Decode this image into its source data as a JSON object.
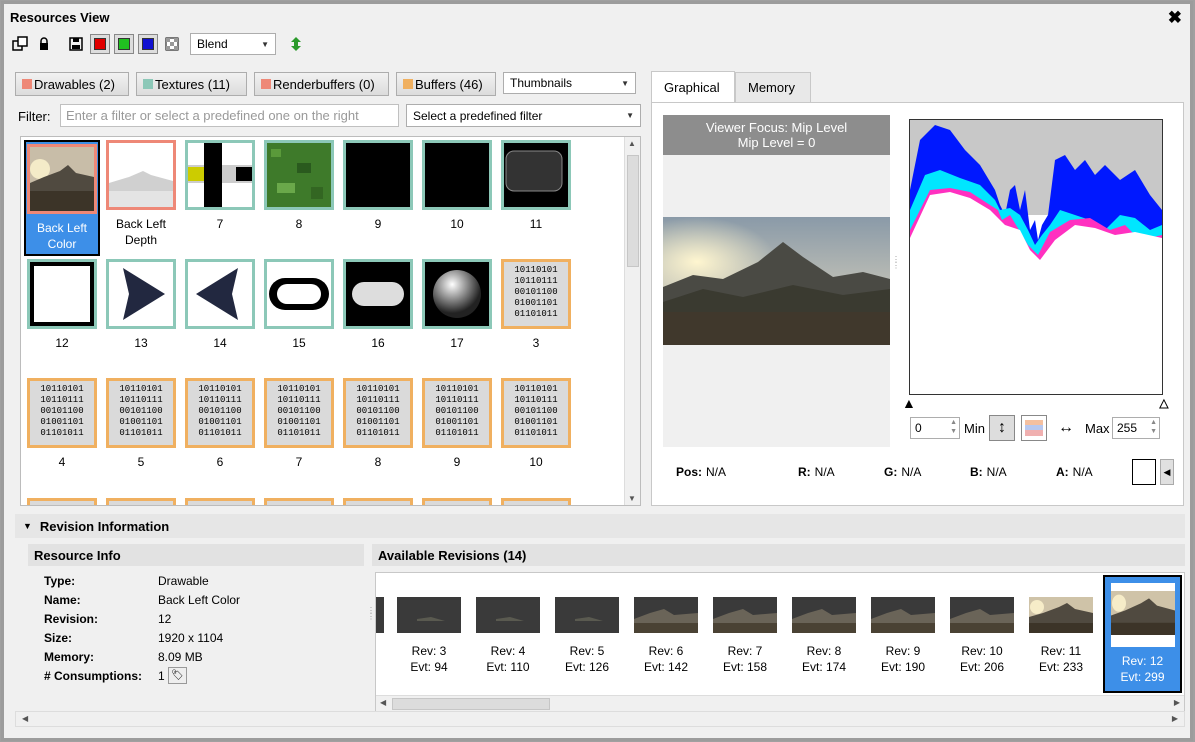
{
  "window": {
    "title": "Resources View",
    "close": "✖"
  },
  "toolbar": {
    "blend": "Blend",
    "colors": {
      "red": "#e00000",
      "green": "#20c020",
      "blue": "#1010d0"
    }
  },
  "types": [
    {
      "label": "Drawables (2)",
      "color": "#ee8877"
    },
    {
      "label": "Textures (11)",
      "color": "#8cc8b8"
    },
    {
      "label": "Renderbuffers (0)",
      "color": "#ee8877"
    },
    {
      "label": "Buffers (46)",
      "color": "#f0b060"
    }
  ],
  "view_mode": "Thumbnails",
  "filter": {
    "label": "Filter:",
    "placeholder": "Enter a filter or select a predefined one on the right",
    "predefined": "Select a predefined filter"
  },
  "resources": [
    {
      "label": "Back Left Color",
      "kind": "drawable",
      "img": "landscape",
      "selected": true
    },
    {
      "label": "Back Left Depth",
      "kind": "drawable",
      "img": "depth"
    },
    {
      "label": "7",
      "kind": "texture",
      "img": "blocks"
    },
    {
      "label": "8",
      "kind": "texture",
      "img": "grass"
    },
    {
      "label": "9",
      "kind": "texture",
      "img": "black"
    },
    {
      "label": "10",
      "kind": "texture",
      "img": "black"
    },
    {
      "label": "11",
      "kind": "texture",
      "img": "roundrect"
    },
    {
      "label": "12",
      "kind": "texture",
      "img": "whitebox"
    },
    {
      "label": "13",
      "kind": "texture",
      "img": "arrowright"
    },
    {
      "label": "14",
      "kind": "texture",
      "img": "arrowleft"
    },
    {
      "label": "15",
      "kind": "texture",
      "img": "pill"
    },
    {
      "label": "16",
      "kind": "texture",
      "img": "pillsolid"
    },
    {
      "label": "17",
      "kind": "texture",
      "img": "sphere"
    },
    {
      "label": "3",
      "kind": "buffer",
      "img": "binary"
    },
    {
      "label": "4",
      "kind": "buffer",
      "img": "binary"
    },
    {
      "label": "5",
      "kind": "buffer",
      "img": "binary"
    },
    {
      "label": "6",
      "kind": "buffer",
      "img": "binary"
    },
    {
      "label": "7",
      "kind": "buffer",
      "img": "binary"
    },
    {
      "label": "8",
      "kind": "buffer",
      "img": "binary"
    },
    {
      "label": "9",
      "kind": "buffer",
      "img": "binary"
    },
    {
      "label": "10",
      "kind": "buffer",
      "img": "binary"
    }
  ],
  "binary_text": [
    "10110101",
    "10110111",
    "00101100",
    "01001101",
    "01101011"
  ],
  "tabs": {
    "graphical": "Graphical",
    "memory": "Memory"
  },
  "viewer": {
    "focus_line1": "Viewer Focus: Mip Level",
    "focus_line2": "Mip Level = 0"
  },
  "histogram": {
    "min_value": "0",
    "min_label": "Min",
    "max_label": "Max",
    "max_value": "255"
  },
  "pixel": {
    "pos_label": "Pos:",
    "pos": "N/A",
    "r_label": "R:",
    "r": "N/A",
    "g_label": "G:",
    "g": "N/A",
    "b_label": "B:",
    "b": "N/A",
    "a_label": "A:",
    "a": "N/A"
  },
  "revision_header": "Revision Information",
  "resource_info": {
    "title": "Resource Info",
    "rows": [
      {
        "key": "Type:",
        "value": "Drawable"
      },
      {
        "key": "Name:",
        "value": "Back Left Color"
      },
      {
        "key": "Revision:",
        "value": "12"
      },
      {
        "key": "Size:",
        "value": "1920 x 1104"
      },
      {
        "key": "Memory:",
        "value": "8.09 MB"
      },
      {
        "key": "# Consumptions:",
        "value": "1"
      }
    ]
  },
  "revisions": {
    "title": "Available Revisions (14)",
    "items": [
      {
        "rev": "Rev: 3",
        "evt": "Evt: 94",
        "img": "dark"
      },
      {
        "rev": "Rev: 4",
        "evt": "Evt: 110",
        "img": "dark"
      },
      {
        "rev": "Rev: 5",
        "evt": "Evt: 126",
        "img": "dark"
      },
      {
        "rev": "Rev: 6",
        "evt": "Evt: 142",
        "img": "darkland"
      },
      {
        "rev": "Rev: 7",
        "evt": "Evt: 158",
        "img": "darkland"
      },
      {
        "rev": "Rev: 8",
        "evt": "Evt: 174",
        "img": "darkland"
      },
      {
        "rev": "Rev: 9",
        "evt": "Evt: 190",
        "img": "darkland"
      },
      {
        "rev": "Rev: 10",
        "evt": "Evt: 206",
        "img": "darkland"
      },
      {
        "rev": "Rev: 11",
        "evt": "Evt: 233",
        "img": "landscape"
      },
      {
        "rev": "Rev: 12",
        "evt": "Evt: 299",
        "img": "landscape",
        "selected": true
      }
    ]
  }
}
